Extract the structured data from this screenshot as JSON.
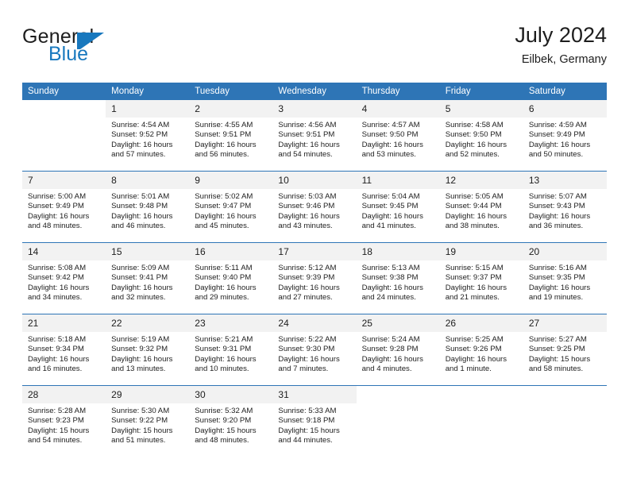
{
  "logo": {
    "word_top": "General",
    "word_bottom": "Blue",
    "accent_color": "#1878be",
    "mark": "triangle-flag"
  },
  "header": {
    "title": "July 2024",
    "subtitle": "Eilbek, Germany"
  },
  "theme": {
    "header_blue": "#2e75b6",
    "daynum_band": "#f2f2f2",
    "text": "#1d1d1d"
  },
  "calendar": {
    "weekday_headers": [
      "Sunday",
      "Monday",
      "Tuesday",
      "Wednesday",
      "Thursday",
      "Friday",
      "Saturday"
    ],
    "weeks": [
      [
        {
          "day": "",
          "lines": []
        },
        {
          "day": "1",
          "lines": [
            "Sunrise: 4:54 AM",
            "Sunset: 9:52 PM",
            "Daylight: 16 hours",
            "and 57 minutes."
          ]
        },
        {
          "day": "2",
          "lines": [
            "Sunrise: 4:55 AM",
            "Sunset: 9:51 PM",
            "Daylight: 16 hours",
            "and 56 minutes."
          ]
        },
        {
          "day": "3",
          "lines": [
            "Sunrise: 4:56 AM",
            "Sunset: 9:51 PM",
            "Daylight: 16 hours",
            "and 54 minutes."
          ]
        },
        {
          "day": "4",
          "lines": [
            "Sunrise: 4:57 AM",
            "Sunset: 9:50 PM",
            "Daylight: 16 hours",
            "and 53 minutes."
          ]
        },
        {
          "day": "5",
          "lines": [
            "Sunrise: 4:58 AM",
            "Sunset: 9:50 PM",
            "Daylight: 16 hours",
            "and 52 minutes."
          ]
        },
        {
          "day": "6",
          "lines": [
            "Sunrise: 4:59 AM",
            "Sunset: 9:49 PM",
            "Daylight: 16 hours",
            "and 50 minutes."
          ]
        }
      ],
      [
        {
          "day": "7",
          "lines": [
            "Sunrise: 5:00 AM",
            "Sunset: 9:49 PM",
            "Daylight: 16 hours",
            "and 48 minutes."
          ]
        },
        {
          "day": "8",
          "lines": [
            "Sunrise: 5:01 AM",
            "Sunset: 9:48 PM",
            "Daylight: 16 hours",
            "and 46 minutes."
          ]
        },
        {
          "day": "9",
          "lines": [
            "Sunrise: 5:02 AM",
            "Sunset: 9:47 PM",
            "Daylight: 16 hours",
            "and 45 minutes."
          ]
        },
        {
          "day": "10",
          "lines": [
            "Sunrise: 5:03 AM",
            "Sunset: 9:46 PM",
            "Daylight: 16 hours",
            "and 43 minutes."
          ]
        },
        {
          "day": "11",
          "lines": [
            "Sunrise: 5:04 AM",
            "Sunset: 9:45 PM",
            "Daylight: 16 hours",
            "and 41 minutes."
          ]
        },
        {
          "day": "12",
          "lines": [
            "Sunrise: 5:05 AM",
            "Sunset: 9:44 PM",
            "Daylight: 16 hours",
            "and 38 minutes."
          ]
        },
        {
          "day": "13",
          "lines": [
            "Sunrise: 5:07 AM",
            "Sunset: 9:43 PM",
            "Daylight: 16 hours",
            "and 36 minutes."
          ]
        }
      ],
      [
        {
          "day": "14",
          "lines": [
            "Sunrise: 5:08 AM",
            "Sunset: 9:42 PM",
            "Daylight: 16 hours",
            "and 34 minutes."
          ]
        },
        {
          "day": "15",
          "lines": [
            "Sunrise: 5:09 AM",
            "Sunset: 9:41 PM",
            "Daylight: 16 hours",
            "and 32 minutes."
          ]
        },
        {
          "day": "16",
          "lines": [
            "Sunrise: 5:11 AM",
            "Sunset: 9:40 PM",
            "Daylight: 16 hours",
            "and 29 minutes."
          ]
        },
        {
          "day": "17",
          "lines": [
            "Sunrise: 5:12 AM",
            "Sunset: 9:39 PM",
            "Daylight: 16 hours",
            "and 27 minutes."
          ]
        },
        {
          "day": "18",
          "lines": [
            "Sunrise: 5:13 AM",
            "Sunset: 9:38 PM",
            "Daylight: 16 hours",
            "and 24 minutes."
          ]
        },
        {
          "day": "19",
          "lines": [
            "Sunrise: 5:15 AM",
            "Sunset: 9:37 PM",
            "Daylight: 16 hours",
            "and 21 minutes."
          ]
        },
        {
          "day": "20",
          "lines": [
            "Sunrise: 5:16 AM",
            "Sunset: 9:35 PM",
            "Daylight: 16 hours",
            "and 19 minutes."
          ]
        }
      ],
      [
        {
          "day": "21",
          "lines": [
            "Sunrise: 5:18 AM",
            "Sunset: 9:34 PM",
            "Daylight: 16 hours",
            "and 16 minutes."
          ]
        },
        {
          "day": "22",
          "lines": [
            "Sunrise: 5:19 AM",
            "Sunset: 9:32 PM",
            "Daylight: 16 hours",
            "and 13 minutes."
          ]
        },
        {
          "day": "23",
          "lines": [
            "Sunrise: 5:21 AM",
            "Sunset: 9:31 PM",
            "Daylight: 16 hours",
            "and 10 minutes."
          ]
        },
        {
          "day": "24",
          "lines": [
            "Sunrise: 5:22 AM",
            "Sunset: 9:30 PM",
            "Daylight: 16 hours",
            "and 7 minutes."
          ]
        },
        {
          "day": "25",
          "lines": [
            "Sunrise: 5:24 AM",
            "Sunset: 9:28 PM",
            "Daylight: 16 hours",
            "and 4 minutes."
          ]
        },
        {
          "day": "26",
          "lines": [
            "Sunrise: 5:25 AM",
            "Sunset: 9:26 PM",
            "Daylight: 16 hours",
            "and 1 minute."
          ]
        },
        {
          "day": "27",
          "lines": [
            "Sunrise: 5:27 AM",
            "Sunset: 9:25 PM",
            "Daylight: 15 hours",
            "and 58 minutes."
          ]
        }
      ],
      [
        {
          "day": "28",
          "lines": [
            "Sunrise: 5:28 AM",
            "Sunset: 9:23 PM",
            "Daylight: 15 hours",
            "and 54 minutes."
          ]
        },
        {
          "day": "29",
          "lines": [
            "Sunrise: 5:30 AM",
            "Sunset: 9:22 PM",
            "Daylight: 15 hours",
            "and 51 minutes."
          ]
        },
        {
          "day": "30",
          "lines": [
            "Sunrise: 5:32 AM",
            "Sunset: 9:20 PM",
            "Daylight: 15 hours",
            "and 48 minutes."
          ]
        },
        {
          "day": "31",
          "lines": [
            "Sunrise: 5:33 AM",
            "Sunset: 9:18 PM",
            "Daylight: 15 hours",
            "and 44 minutes."
          ]
        },
        {
          "day": "",
          "lines": []
        },
        {
          "day": "",
          "lines": []
        },
        {
          "day": "",
          "lines": []
        }
      ]
    ]
  }
}
